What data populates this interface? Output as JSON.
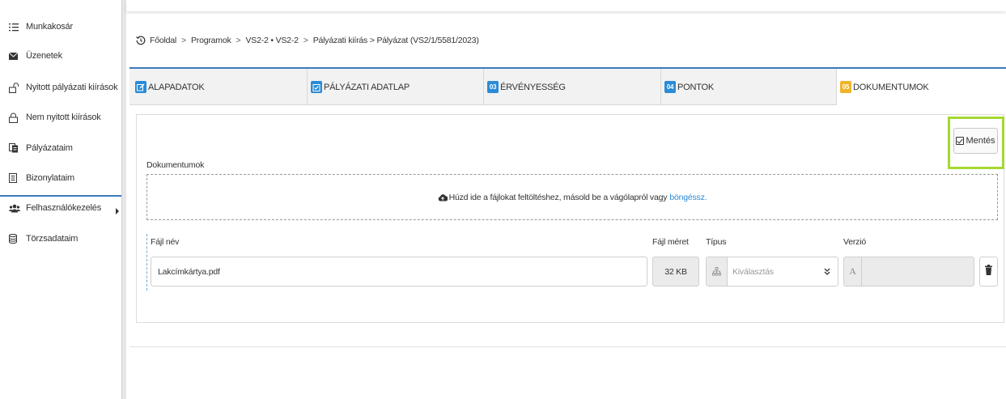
{
  "sidebar": {
    "items": [
      {
        "label": "Munkakosár",
        "icon": "list-icon"
      },
      {
        "label": "Üzenetek",
        "icon": "envelope-icon"
      },
      {
        "label": "Nyitott pályázati kiírások",
        "icon": "unlock-icon"
      },
      {
        "label": "Nem nyitott kiírások",
        "icon": "lock-icon"
      },
      {
        "label": "Pályázataim",
        "icon": "files-icon"
      },
      {
        "label": "Bizonylataim",
        "icon": "document-icon"
      },
      {
        "label": "Felhasználókezelés",
        "icon": "users-icon"
      },
      {
        "label": "Törzsadataim",
        "icon": "database-icon"
      }
    ]
  },
  "breadcrumb": {
    "items": [
      "Főoldal",
      "Programok",
      "VS2-2 • VS2-2",
      "Pályázati kiírás > Pályázat (VS2/1/5581/2023)"
    ]
  },
  "tabs": [
    {
      "badge": "",
      "label": "ALAPADATOK",
      "icon": "edit-icon"
    },
    {
      "badge": "",
      "label": "PÁLYÁZATI ADATLAP",
      "icon": "checklist-icon"
    },
    {
      "badge": "03",
      "label": "ÉRVÉNYESSÉG"
    },
    {
      "badge": "04",
      "label": "PONTOK"
    },
    {
      "badge": "05",
      "label": "DOKUMENTUMOK"
    }
  ],
  "save_label": "Mentés",
  "documents": {
    "section_label": "Dokumentumok",
    "dropzone_text": "Húzd ide a fájlokat feltöltéshez, másold be a vágólapról vagy",
    "dropzone_link": "böngéssz.",
    "columns": {
      "filename": "Fájl név",
      "size": "Fájl méret",
      "type": "Típus",
      "version": "Verzió"
    },
    "file": {
      "name": "Lakcímkártya.pdf",
      "size": "32 KB",
      "type_placeholder": "Kiválasztás",
      "version_prefix": "A"
    }
  },
  "colors": {
    "accent_blue": "#3a7bb8",
    "badge_blue": "#2b8bd6",
    "badge_yellow": "#f0b42a",
    "highlight_green": "#a5d832"
  }
}
